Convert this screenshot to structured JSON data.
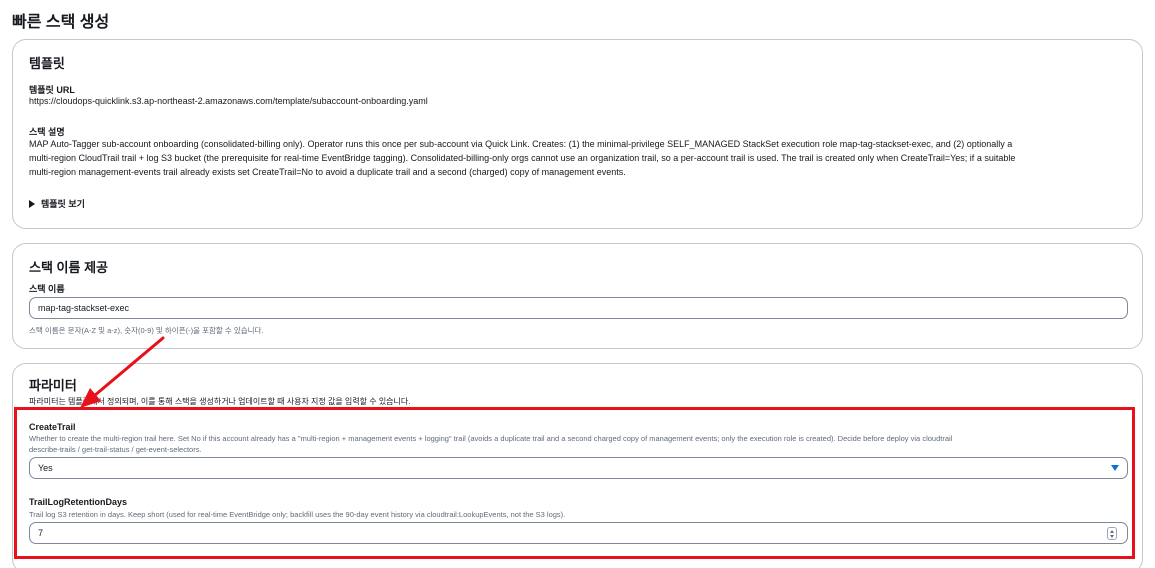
{
  "page": {
    "title": "빠른 스택 생성"
  },
  "template_section": {
    "title": "템플릿",
    "url_label": "템플릿 URL",
    "url_value": "https://cloudops-quicklink.s3.ap-northeast-2.amazonaws.com/template/subaccount-onboarding.yaml",
    "description_label": "스택 설명",
    "description_line1": "MAP Auto-Tagger sub-account onboarding (consolidated-billing only). Operator runs this once per sub-account via Quick Link. Creates: (1) the minimal-privilege SELF_MANAGED StackSet execution role map-tag-stackset-exec, and (2) optionally a",
    "description_line2": "multi-region CloudTrail trail + log S3 bucket (the prerequisite for real-time EventBridge tagging). Consolidated-billing-only orgs cannot use an organization trail, so a per-account trail is used. The trail is created only when CreateTrail=Yes; if a suitable",
    "description_line3": "multi-region management-events trail already exists set CreateTrail=No to avoid a duplicate trail and a second (charged) copy of management events.",
    "view_template_label": "템플릿 보기"
  },
  "stack_name_section": {
    "title": "스택 이름 제공",
    "field_label": "스택 이름",
    "field_value": "map-tag-stackset-exec",
    "hint": "스택 이름은 문자(A-Z 및 a-z), 숫자(0-9) 및 하이픈(-)을 포함할 수 있습니다."
  },
  "parameters_section": {
    "title": "파라미터",
    "description": "파라미터는 템플릿에서 정의되며, 이를 통해 스택을 생성하거나 업데이트할 때 사용자 지정 값을 입력할 수 있습니다.",
    "params": [
      {
        "name": "CreateTrail",
        "desc_line1": "Whether to create the multi-region trail here. Set No if this account already has a \"multi-region + management events + logging\" trail (avoids a duplicate trail and a second charged copy of management events; only the execution role is created). Decide before deploy via cloudtrail",
        "desc_line2": "describe-trails / get-trail-status / get-event-selectors.",
        "value": "Yes"
      },
      {
        "name": "TrailLogRetentionDays",
        "desc_line1": "Trail log S3 retention in days. Keep short (used for real-time EventBridge only; backfill uses the 90-day event history via cloudtrail:LookupEvents, not the S3 logs).",
        "value": "7"
      }
    ]
  },
  "colors": {
    "highlight": "#e8101a",
    "accent": "#0972d3",
    "border": "#c6c6cd"
  }
}
